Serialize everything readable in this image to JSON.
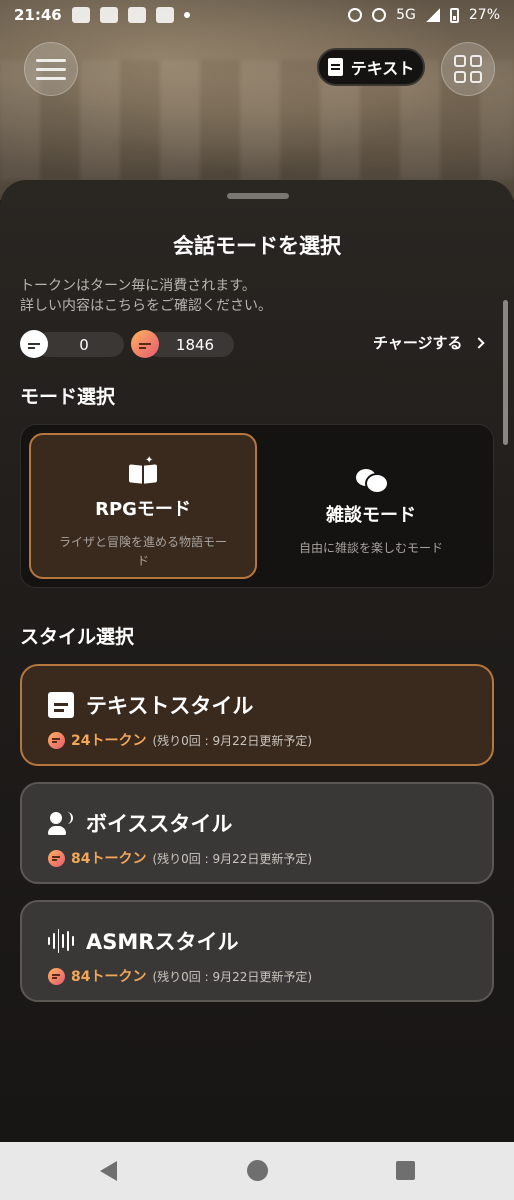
{
  "status_bar": {
    "time": "21:46",
    "network": "5G",
    "battery": "27%"
  },
  "top_bar": {
    "text_toggle_label": "テキスト"
  },
  "sheet": {
    "title": "会話モードを選択",
    "info_line1": "トークンはターン毎に消費されます。",
    "info_line2": "詳しい内容はこちらをご確認ください。",
    "free_tokens": "0",
    "paid_tokens": "1846",
    "charge_label": "チャージする",
    "mode_section_label": "モード選択",
    "modes": [
      {
        "title": "RPGモード",
        "desc_line1": "ライザと冒険を進める物語モー",
        "desc_line2": "ド",
        "selected": true
      },
      {
        "title": "雑談モード",
        "desc_line1": "自由に雑談を楽しむモード",
        "selected": false
      }
    ],
    "style_section_label": "スタイル選択",
    "styles": [
      {
        "title": "テキストスタイル",
        "cost": "24トークン",
        "note": "(残り0回 : 9月22日更新予定)",
        "selected": true
      },
      {
        "title": "ボイススタイル",
        "cost": "84トークン",
        "note": "(残り0回 : 9月22日更新予定)",
        "selected": false
      },
      {
        "title": "ASMRスタイル",
        "cost": "84トークン",
        "note": "(残り0回 : 9月22日更新予定)",
        "selected": false
      }
    ]
  },
  "colors": {
    "accent": "#b5773e",
    "cost": "#f2a65a"
  }
}
